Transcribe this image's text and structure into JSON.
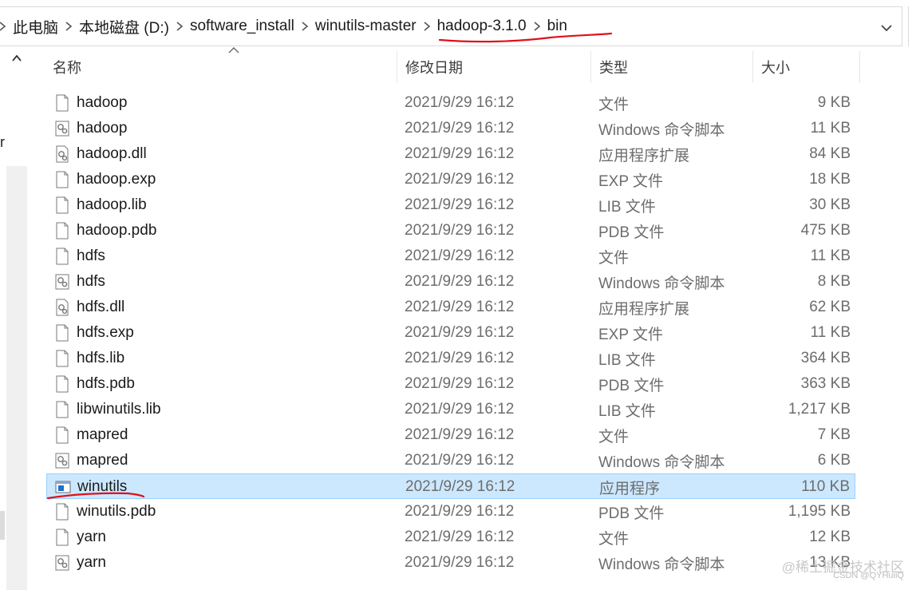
{
  "breadcrumb": [
    "此电脑",
    "本地磁盘 (D:)",
    "software_install",
    "winutils-master",
    "hadoop-3.1.0",
    "bin"
  ],
  "nav_partial_letter": "r",
  "columns": {
    "name": "名称",
    "date": "修改日期",
    "type": "类型",
    "size": "大小"
  },
  "files": [
    {
      "name": "hadoop",
      "date": "2021/9/29 16:12",
      "type": "文件",
      "size": "9 KB",
      "icon": "blank-file-icon"
    },
    {
      "name": "hadoop",
      "date": "2021/9/29 16:12",
      "type": "Windows 命令脚本",
      "size": "11 KB",
      "icon": "script-file-icon"
    },
    {
      "name": "hadoop.dll",
      "date": "2021/9/29 16:12",
      "type": "应用程序扩展",
      "size": "84 KB",
      "icon": "dll-file-icon"
    },
    {
      "name": "hadoop.exp",
      "date": "2021/9/29 16:12",
      "type": "EXP 文件",
      "size": "18 KB",
      "icon": "blank-file-icon"
    },
    {
      "name": "hadoop.lib",
      "date": "2021/9/29 16:12",
      "type": "LIB 文件",
      "size": "30 KB",
      "icon": "blank-file-icon"
    },
    {
      "name": "hadoop.pdb",
      "date": "2021/9/29 16:12",
      "type": "PDB 文件",
      "size": "475 KB",
      "icon": "blank-file-icon"
    },
    {
      "name": "hdfs",
      "date": "2021/9/29 16:12",
      "type": "文件",
      "size": "11 KB",
      "icon": "blank-file-icon"
    },
    {
      "name": "hdfs",
      "date": "2021/9/29 16:12",
      "type": "Windows 命令脚本",
      "size": "8 KB",
      "icon": "script-file-icon"
    },
    {
      "name": "hdfs.dll",
      "date": "2021/9/29 16:12",
      "type": "应用程序扩展",
      "size": "62 KB",
      "icon": "dll-file-icon"
    },
    {
      "name": "hdfs.exp",
      "date": "2021/9/29 16:12",
      "type": "EXP 文件",
      "size": "11 KB",
      "icon": "blank-file-icon"
    },
    {
      "name": "hdfs.lib",
      "date": "2021/9/29 16:12",
      "type": "LIB 文件",
      "size": "364 KB",
      "icon": "blank-file-icon"
    },
    {
      "name": "hdfs.pdb",
      "date": "2021/9/29 16:12",
      "type": "PDB 文件",
      "size": "363 KB",
      "icon": "blank-file-icon"
    },
    {
      "name": "libwinutils.lib",
      "date": "2021/9/29 16:12",
      "type": "LIB 文件",
      "size": "1,217 KB",
      "icon": "blank-file-icon"
    },
    {
      "name": "mapred",
      "date": "2021/9/29 16:12",
      "type": "文件",
      "size": "7 KB",
      "icon": "blank-file-icon"
    },
    {
      "name": "mapred",
      "date": "2021/9/29 16:12",
      "type": "Windows 命令脚本",
      "size": "6 KB",
      "icon": "script-file-icon"
    },
    {
      "name": "winutils",
      "date": "2021/9/29 16:12",
      "type": "应用程序",
      "size": "110 KB",
      "icon": "exe-file-icon",
      "selected": true
    },
    {
      "name": "winutils.pdb",
      "date": "2021/9/29 16:12",
      "type": "PDB 文件",
      "size": "1,195 KB",
      "icon": "blank-file-icon"
    },
    {
      "name": "yarn",
      "date": "2021/9/29 16:12",
      "type": "文件",
      "size": "12 KB",
      "icon": "blank-file-icon"
    },
    {
      "name": "yarn",
      "date": "2021/9/29 16:12",
      "type": "Windows 命令脚本",
      "size": "13 KB",
      "icon": "script-file-icon"
    }
  ],
  "watermark": {
    "line1": "@稀土掘金技术社区",
    "line2": "CSDN @QYHuiiQ"
  },
  "colors": {
    "selection_bg": "#cce8ff",
    "selection_border": "#99d1ff",
    "annotation_red": "#e0101a"
  }
}
